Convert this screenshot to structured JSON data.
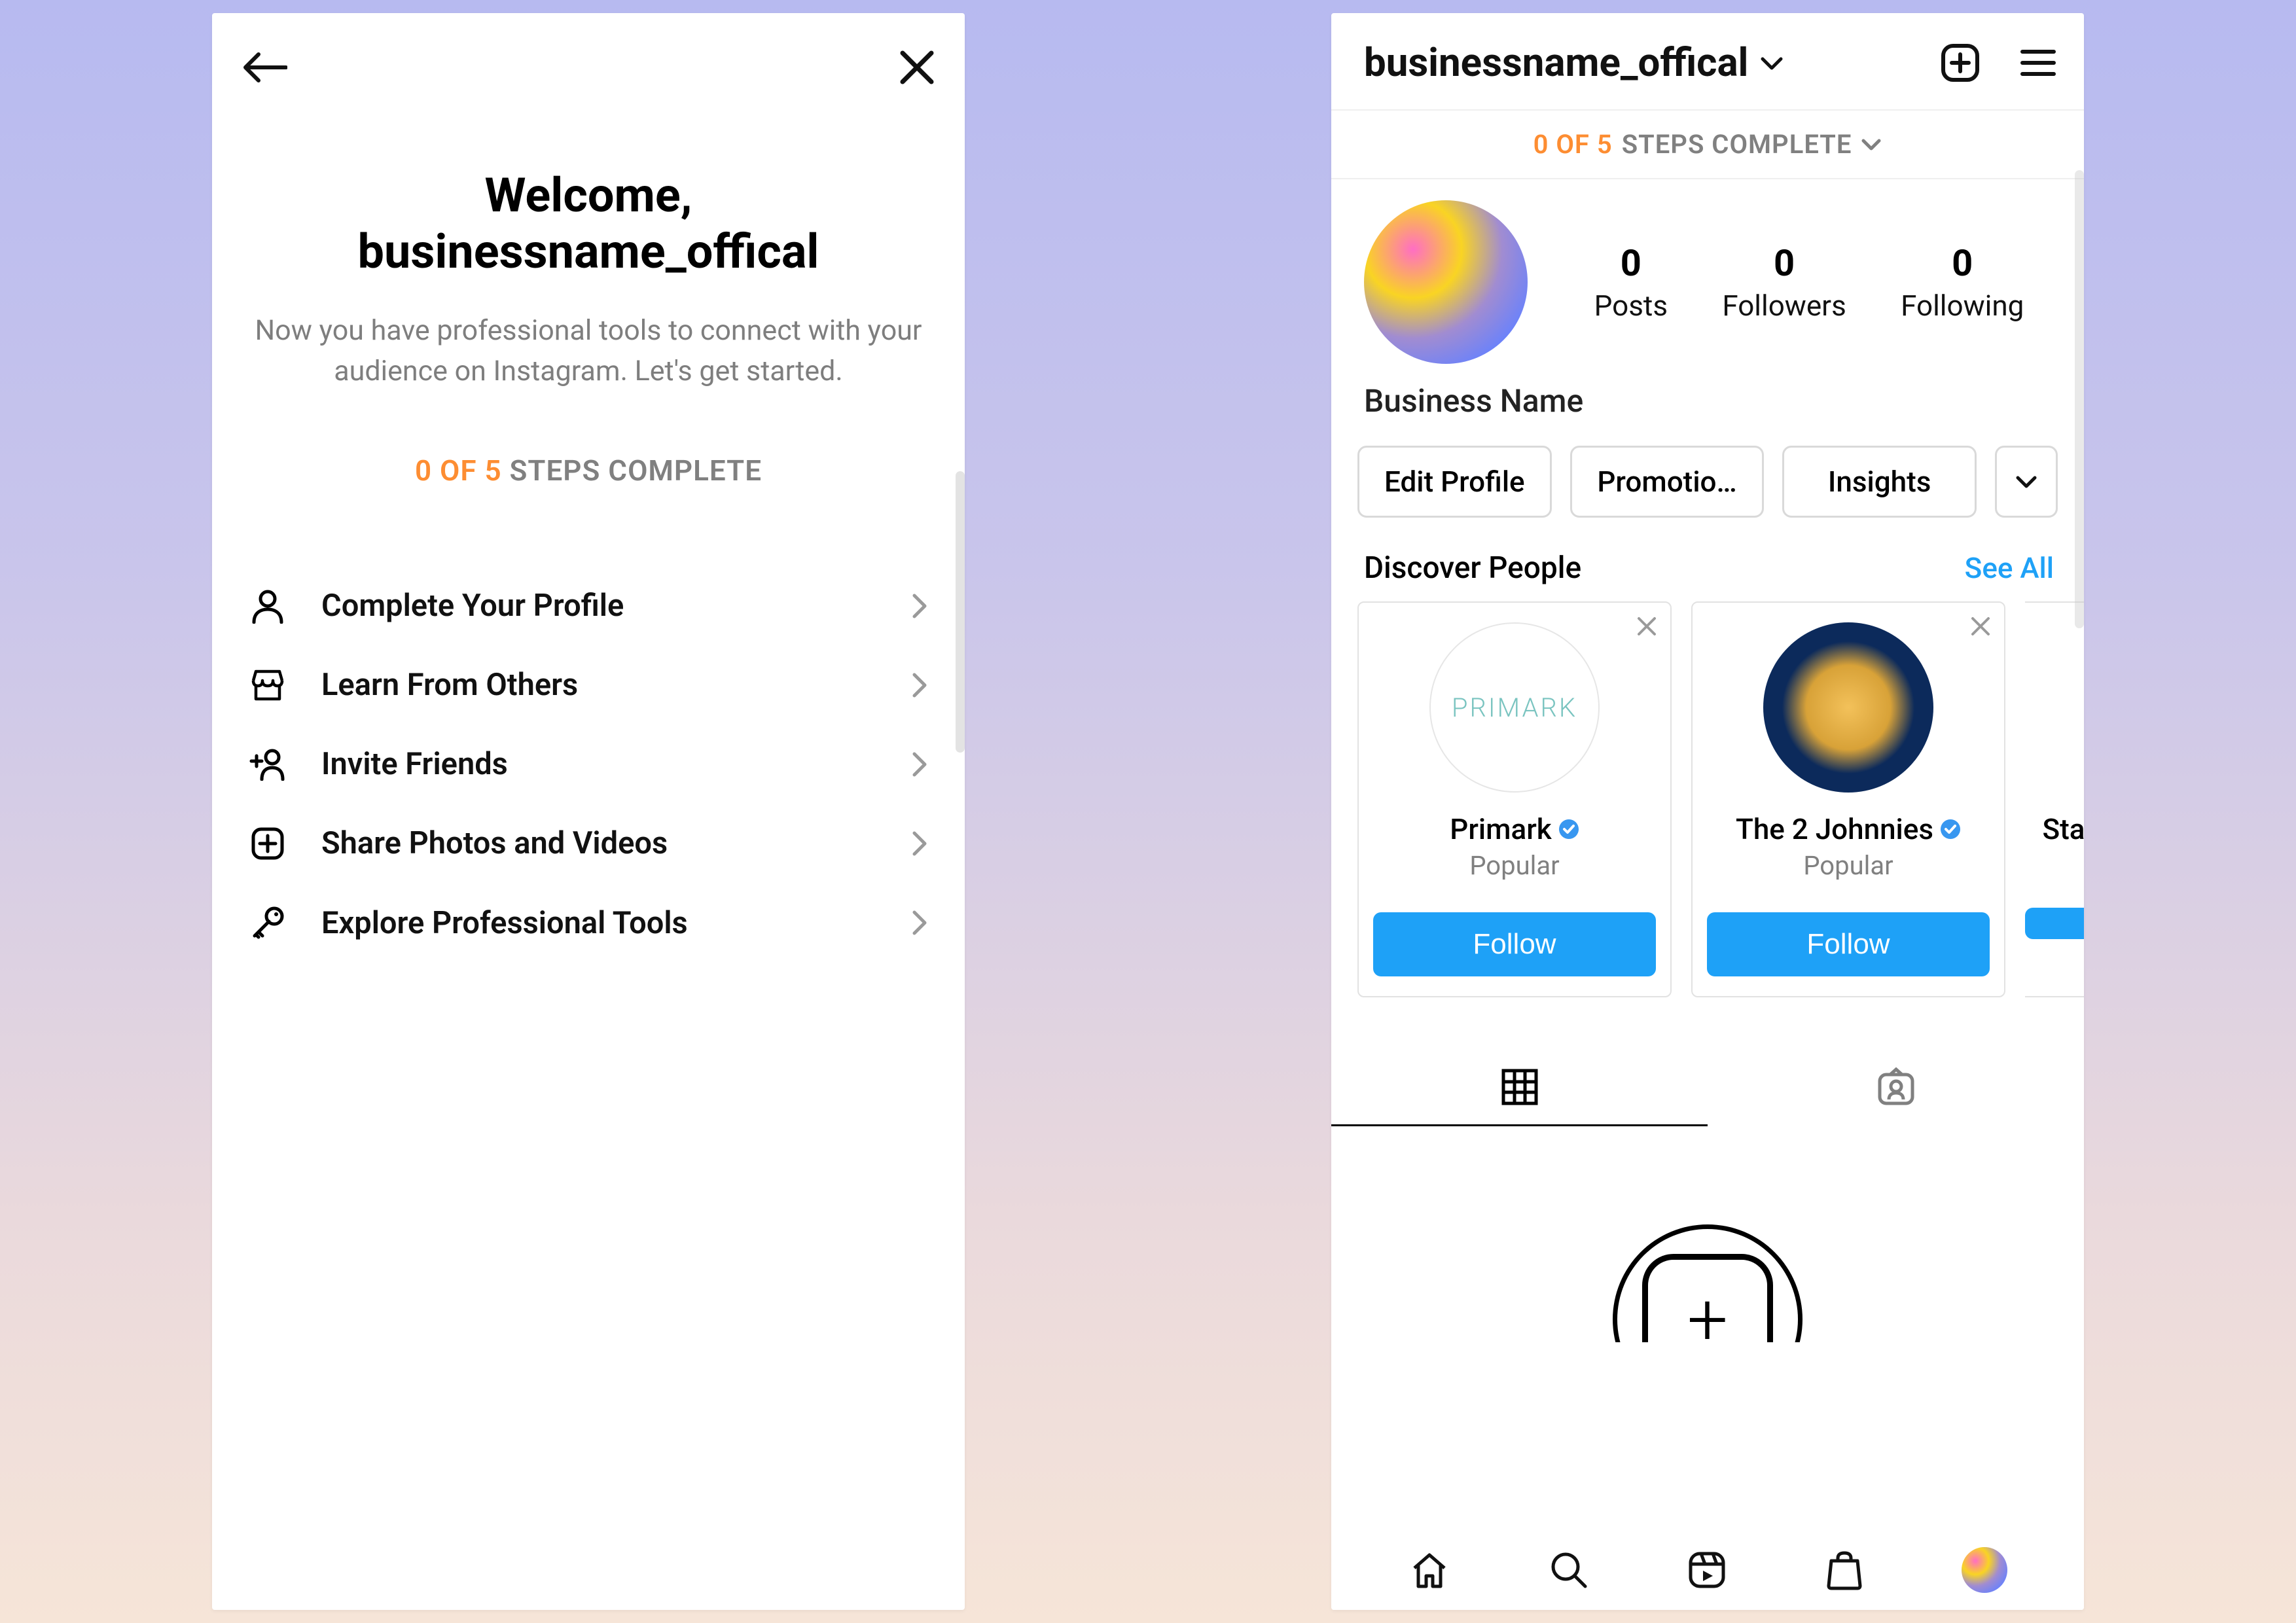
{
  "left": {
    "welcome_line1": "Welcome,",
    "welcome_line2": "businessname_offical",
    "description": "Now you have professional tools to connect with your audience on Instagram. Let's get started.",
    "progress_highlight": "0 OF 5",
    "progress_rest": " STEPS COMPLETE",
    "items": [
      {
        "label": "Complete Your Profile",
        "icon": "person-icon"
      },
      {
        "label": "Learn From Others",
        "icon": "storefront-icon"
      },
      {
        "label": "Invite Friends",
        "icon": "add-person-icon"
      },
      {
        "label": "Share Photos and Videos",
        "icon": "plus-square-icon"
      },
      {
        "label": "Explore Professional Tools",
        "icon": "key-icon"
      }
    ]
  },
  "right": {
    "username": "businessname_offical",
    "banner_highlight": "0 OF 5",
    "banner_rest": " STEPS COMPLETE",
    "stats": {
      "posts": {
        "num": "0",
        "label": "Posts"
      },
      "followers": {
        "num": "0",
        "label": "Followers"
      },
      "following": {
        "num": "0",
        "label": "Following"
      }
    },
    "display_name": "Business Name",
    "buttons": {
      "edit": "Edit Profile",
      "promo": "Promotio…",
      "insights": "Insights"
    },
    "discover_title": "Discover People",
    "see_all": "See All",
    "cards": [
      {
        "name": "Primark",
        "subtitle": "Popular",
        "follow": "Follow",
        "verified": true,
        "avatar_text": "PRIMARK"
      },
      {
        "name": "The 2 Johnnies",
        "subtitle": "Popular",
        "follow": "Follow",
        "verified": true
      },
      {
        "name": "Sta",
        "follow": ""
      }
    ]
  }
}
